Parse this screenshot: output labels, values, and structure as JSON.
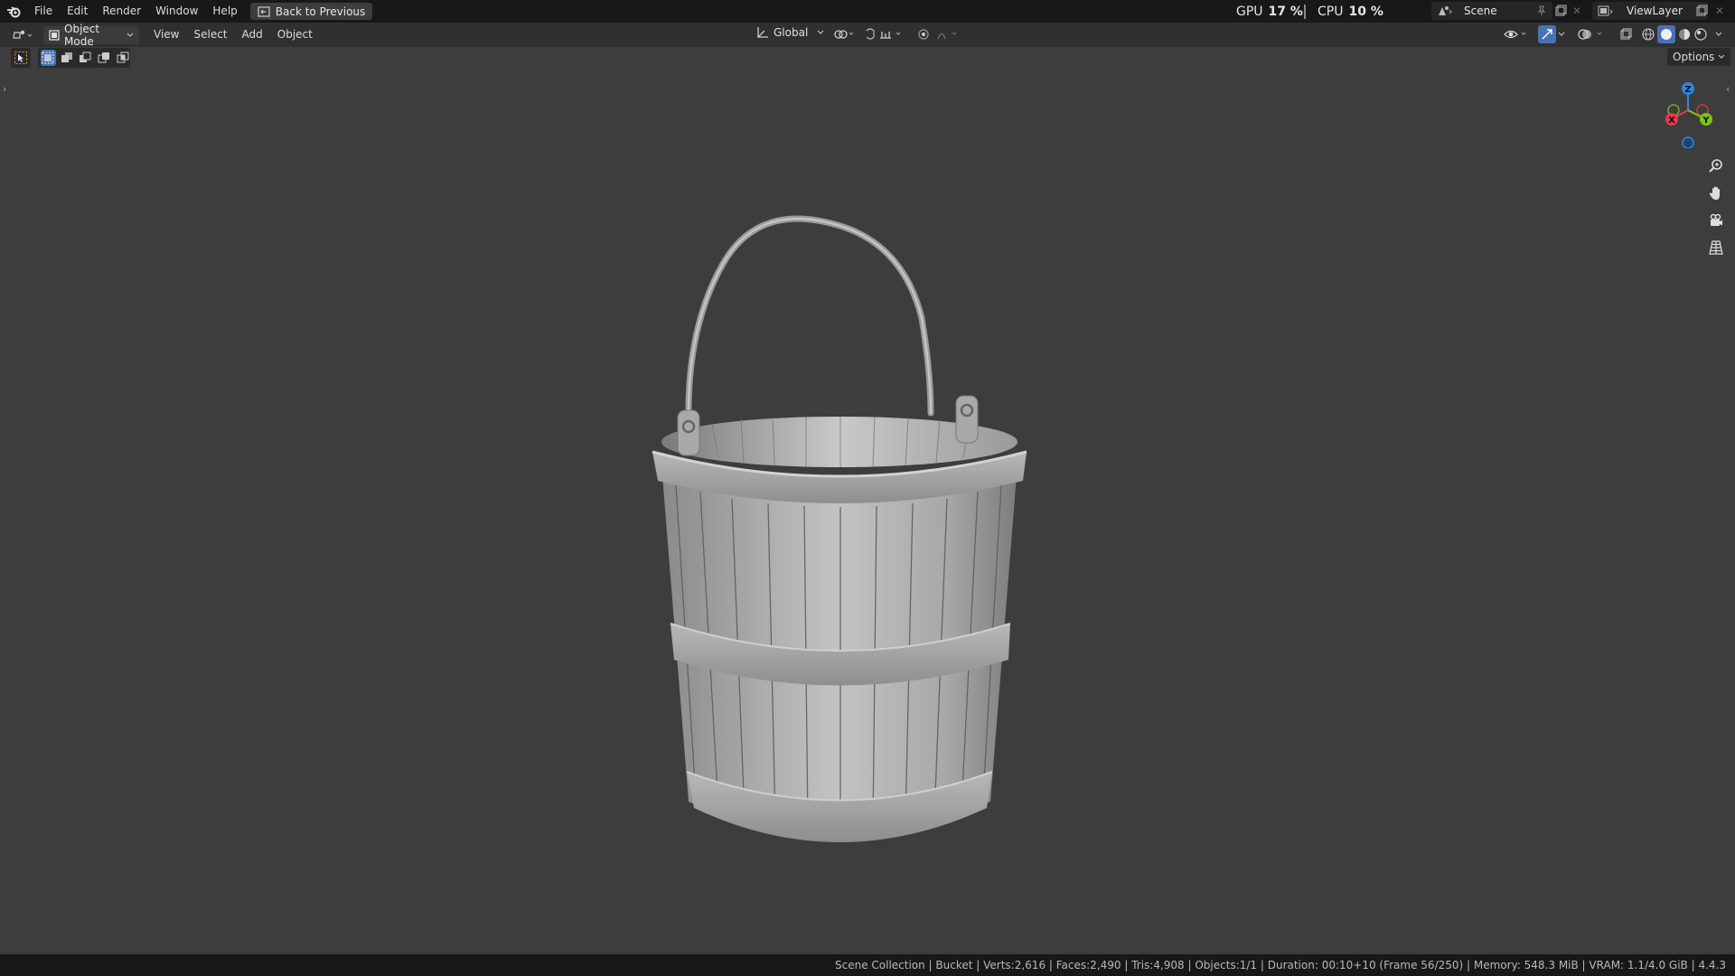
{
  "topbar": {
    "menus": [
      "File",
      "Edit",
      "Render",
      "Window",
      "Help"
    ],
    "back_button": "Back to Previous",
    "gpu_label": "GPU",
    "gpu_value": "17 %",
    "cpu_label": "CPU",
    "cpu_value": "10 %",
    "scene_name": "Scene",
    "view_layer": "ViewLayer"
  },
  "header": {
    "mode": "Object Mode",
    "menus": [
      "View",
      "Select",
      "Add",
      "Object"
    ],
    "orientation": "Global",
    "options_label": "Options"
  },
  "gizmo": {
    "x": "X",
    "y": "Y",
    "z": "Z"
  },
  "statusbar": {
    "text": "Scene Collection | Bucket | Verts:2,616 | Faces:2,490 | Tris:4,908 | Objects:1/1 | Duration: 00:10+10 (Frame 56/250) | Memory: 548.3 MiB | VRAM: 1.1/4.0 GiB | 4.4.3"
  },
  "colors": {
    "axis_x": "#e8374e",
    "axis_y": "#7cc51b",
    "axis_z": "#2d86e5",
    "accent": "#4772b3"
  },
  "icons": [
    "blender-logo-icon",
    "back-icon",
    "editor-type-icon",
    "mode-icon",
    "select-box-icon",
    "transform-orientation-icon",
    "pivot-icon",
    "snap-icon",
    "proportional-edit-icon",
    "visibility-icon",
    "gizmo-icon",
    "overlay-icon",
    "xray-icon",
    "shading-wireframe-icon",
    "shading-solid-icon",
    "shading-material-icon",
    "shading-rendered-icon",
    "zoom-icon",
    "pan-hand-icon",
    "camera-icon",
    "perspective-grid-icon"
  ]
}
